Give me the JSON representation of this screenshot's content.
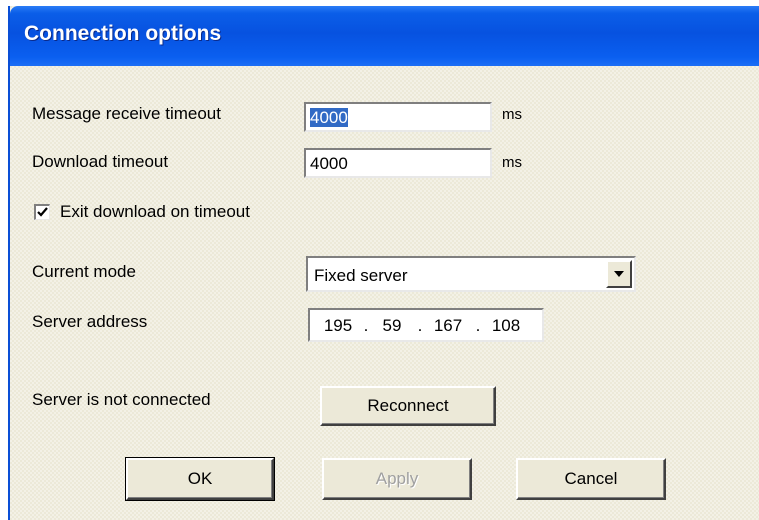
{
  "window": {
    "title": "Connection options"
  },
  "fields": {
    "message_receive_timeout": {
      "label": "Message receive timeout",
      "value": "4000",
      "unit": "ms"
    },
    "download_timeout": {
      "label": "Download timeout",
      "value": "4000",
      "unit": "ms"
    },
    "exit_download": {
      "label": "Exit download on timeout",
      "checked": true
    },
    "current_mode": {
      "label": "Current mode",
      "value": "Fixed server"
    },
    "server_address": {
      "label": "Server address",
      "octets": [
        "195",
        "59",
        "167",
        "108"
      ]
    }
  },
  "status": {
    "text": "Server is not connected",
    "reconnect_label": "Reconnect"
  },
  "buttons": {
    "ok": "OK",
    "apply": "Apply",
    "cancel": "Cancel"
  },
  "icons": {
    "check": "check-icon",
    "dropdown": "chevron-down-icon"
  }
}
